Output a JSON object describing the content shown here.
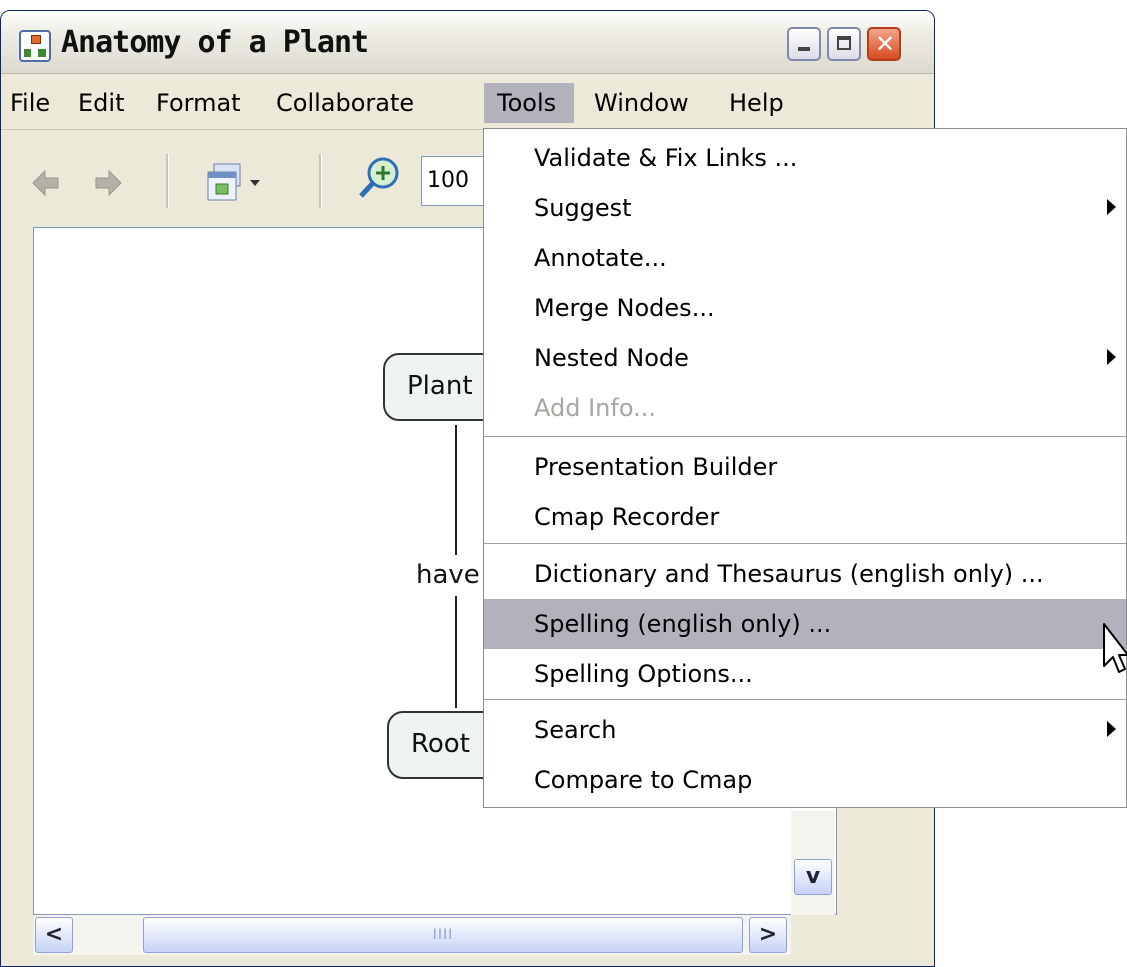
{
  "window": {
    "title": "Anatomy of a Plant",
    "close_glyph": "✕"
  },
  "menubar": {
    "items": [
      {
        "label": "File",
        "active": false
      },
      {
        "label": "Edit",
        "active": false
      },
      {
        "label": "Format",
        "active": false
      },
      {
        "label": "Collaborate",
        "active": false
      },
      {
        "label": "Tools",
        "active": true
      },
      {
        "label": "Window",
        "active": false
      },
      {
        "label": "Help",
        "active": false
      }
    ]
  },
  "toolbar": {
    "zoom_value": "100",
    "icons": [
      "back-arrow-icon",
      "forward-arrow-icon",
      "view-dropdown-icon",
      "zoom-in-icon"
    ]
  },
  "cmap": {
    "nodes": [
      {
        "label": "Plant"
      },
      {
        "label": "Root"
      }
    ],
    "link_label": "have"
  },
  "tools_menu": {
    "groups": [
      [
        {
          "label": "Validate & Fix Links ...",
          "submenu": false,
          "disabled": false
        },
        {
          "label": "Suggest",
          "submenu": true,
          "disabled": false
        },
        {
          "label": "Annotate...",
          "submenu": false,
          "disabled": false
        },
        {
          "label": "Merge Nodes...",
          "submenu": false,
          "disabled": false
        },
        {
          "label": "Nested Node",
          "submenu": true,
          "disabled": false
        },
        {
          "label": "Add Info...",
          "submenu": false,
          "disabled": true
        }
      ],
      [
        {
          "label": "Presentation Builder",
          "submenu": false,
          "disabled": false
        },
        {
          "label": "Cmap Recorder",
          "submenu": false,
          "disabled": false
        }
      ],
      [
        {
          "label": "Dictionary and Thesaurus (english only) ...",
          "submenu": false,
          "disabled": false
        },
        {
          "label": "Spelling (english only) ...",
          "submenu": false,
          "disabled": false,
          "highlighted": true
        },
        {
          "label": "Spelling Options...",
          "submenu": false,
          "disabled": false
        }
      ],
      [
        {
          "label": "Search",
          "submenu": true,
          "disabled": false
        },
        {
          "label": "Compare to Cmap",
          "submenu": false,
          "disabled": false
        }
      ]
    ]
  },
  "scrollbars": {
    "left_arrow": "<",
    "right_arrow": ">",
    "down_arrow": "v",
    "thumb_grip": "IIII"
  }
}
